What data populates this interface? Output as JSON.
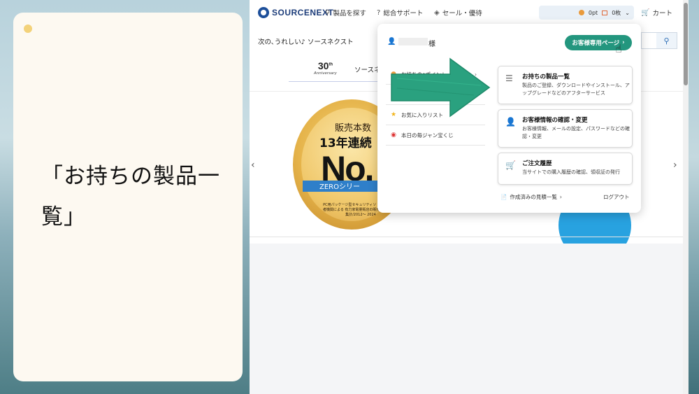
{
  "caption": {
    "text": "「お持ちの製品一覧」"
  },
  "topnav": {
    "logo": "SOURCENEXT",
    "items": [
      {
        "icon": "search-icon",
        "label": "製品を探す"
      },
      {
        "icon": "question-icon",
        "label": "総合サポート"
      },
      {
        "icon": "tag-icon",
        "label": "セール・優待"
      }
    ],
    "points": "0pt",
    "tickets": "0枚",
    "cart": "カート"
  },
  "page": {
    "tagline": "次の､うれしい♪ ソースネクスト",
    "anniversary_number": "30",
    "anniversary_sup": "th",
    "anniversary_label": "Anniversary",
    "sub_tab": "ソースネ",
    "banner": {
      "line1": "販売本数",
      "line2": "13年連続",
      "line3": "No.",
      "line4": "ZEROシリー",
      "fine_print": "PC用パッケージ型セキュリティソ 販売本数第三者機関による 有力家電量販店の販売実績を 自社集計/2012～ 2024"
    }
  },
  "dropdown": {
    "user_suffix": "様",
    "member_button": "お客様専用ページ",
    "menu_left": [
      {
        "icon": "point-icon",
        "label": "お持ちのeポイント"
      },
      {
        "icon": "coupon-icon",
        "label": ""
      },
      {
        "icon": "star-icon",
        "label": "お気に入りリスト"
      },
      {
        "icon": "lottery-icon",
        "label": "本日の毎ジャン宝くじ"
      }
    ],
    "cards": [
      {
        "icon": "list-icon",
        "title": "お持ちの製品一覧",
        "desc": "製品のご登録、ダウンロードやインストール、アップグレードなどのアフターサービス"
      },
      {
        "icon": "user-icon",
        "title": "お客様情報の確認・変更",
        "desc": "お客様情報、メールの設定、パスワードなどの確認・変更"
      },
      {
        "icon": "cart-icon",
        "title": "ご注文履歴",
        "desc": "当サイトでの購入履歴の確認、領収証の発行"
      }
    ],
    "estimate_link": "作成済みの見積一覧",
    "logout": "ログアウト"
  },
  "colors": {
    "accent": "#23967e",
    "arrow": "#2aa17f",
    "banner_blue": "#28a2e0",
    "caption_bg": "#fdf9f1"
  }
}
